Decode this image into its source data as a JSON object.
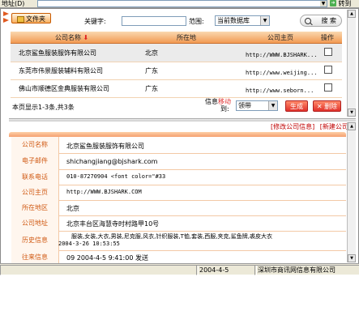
{
  "browser": {
    "address_label": "地址(D)",
    "go_label": "转到"
  },
  "toolbar": {
    "files_tab": "文件夹",
    "keyword_label": "关键字:",
    "keyword_value": "",
    "scope_label": "范围:",
    "scope_value": "当前数据库",
    "search_button": "搜 索"
  },
  "table": {
    "headers": [
      "公司名称",
      "所在地",
      "公司主页",
      "操作"
    ],
    "rows": [
      {
        "name": "北京鲨鱼服装服饰有限公司",
        "location": "北京",
        "url": "http://WWW.BJSHARK..."
      },
      {
        "name": "东莞市伟景服装辅料有限公司",
        "location": "广东",
        "url": "http://www.weijing..."
      },
      {
        "name": "佛山市顺德区金典服装有限公司",
        "location": "广东",
        "url": "http://www.seborn..."
      }
    ]
  },
  "pager": {
    "summary": "本页显示1-3条,共3条",
    "info_label": "信息",
    "move_label": "移动",
    "to_label": "到:",
    "target_value": "领带",
    "confirm_button": "生成",
    "delete_button": "删除"
  },
  "links": {
    "edit": "[修改公司信息]",
    "new": "[新建公司]"
  },
  "detail": {
    "fields": [
      {
        "label": "公司名称",
        "value": "北京鲨鱼服装服饰有限公司"
      },
      {
        "label": "电子邮件",
        "value": "shichangjiang@bjshark.com"
      },
      {
        "label": "联系电话",
        "value": "010-87270904    <font color=\"#33"
      },
      {
        "label": "公司主页",
        "value": "http://WWW.BJSHARK.COM"
      },
      {
        "label": "所在地区",
        "value": "北京"
      },
      {
        "label": "公司地址",
        "value": "北京丰台区海慧寺时村路甲10号"
      },
      {
        "label": "历史信息",
        "value": "服装,女装,大衣,男装,尼克服,风衣,针织服装,T恤,套装,西服,夹克,鲨鱼牌,裘皮大衣",
        "value2": "2004-3-26 10:53:55"
      },
      {
        "label": "往来信息",
        "value": "09  2004-4-5 9:41:00 发送"
      }
    ]
  },
  "status": {
    "date": "2004-4-5",
    "company": "深圳市商讯网信息有限公司"
  }
}
